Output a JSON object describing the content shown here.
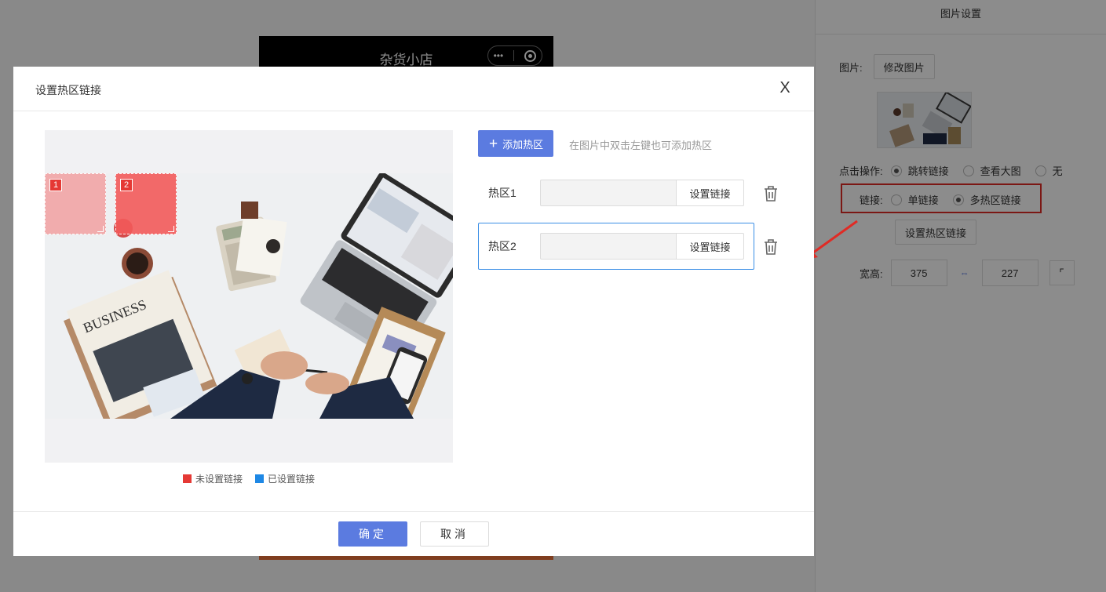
{
  "phone": {
    "title": "杂货小店",
    "capsule_dots": "•••"
  },
  "right_panel": {
    "title": "图片设置",
    "image_label": "图片:",
    "change_image_btn": "修改图片",
    "click_action_label": "点击操作:",
    "click_options": [
      "跳转链接",
      "查看大图",
      "无"
    ],
    "click_selected": "跳转链接",
    "link_label": "链接:",
    "link_options": [
      "单链接",
      "多热区链接"
    ],
    "link_selected": "多热区链接",
    "set_hotzone_btn": "设置热区链接",
    "size_label": "宽高:",
    "width": "375",
    "height": "227"
  },
  "dialog": {
    "title": "设置热区链接",
    "close": "X",
    "add_btn": "添加热区",
    "add_hint": "在图片中双击左键也可添加热区",
    "hotzones": [
      {
        "label": "热区1",
        "link_btn": "设置链接",
        "value": "",
        "number": "1",
        "color": "#f2a7a7"
      },
      {
        "label": "热区2",
        "link_btn": "设置链接",
        "value": "",
        "number": "2",
        "color": "#f26a6a"
      }
    ],
    "legend": [
      {
        "label": "未设置链接",
        "color": "#e53935"
      },
      {
        "label": "已设置链接",
        "color": "#1e88e5"
      }
    ],
    "ok_btn": "确定",
    "cancel_btn": "取消"
  },
  "colors": {
    "primary": "#5b7be0",
    "highlight": "#e02b25",
    "active_border": "#3a8ee6"
  }
}
